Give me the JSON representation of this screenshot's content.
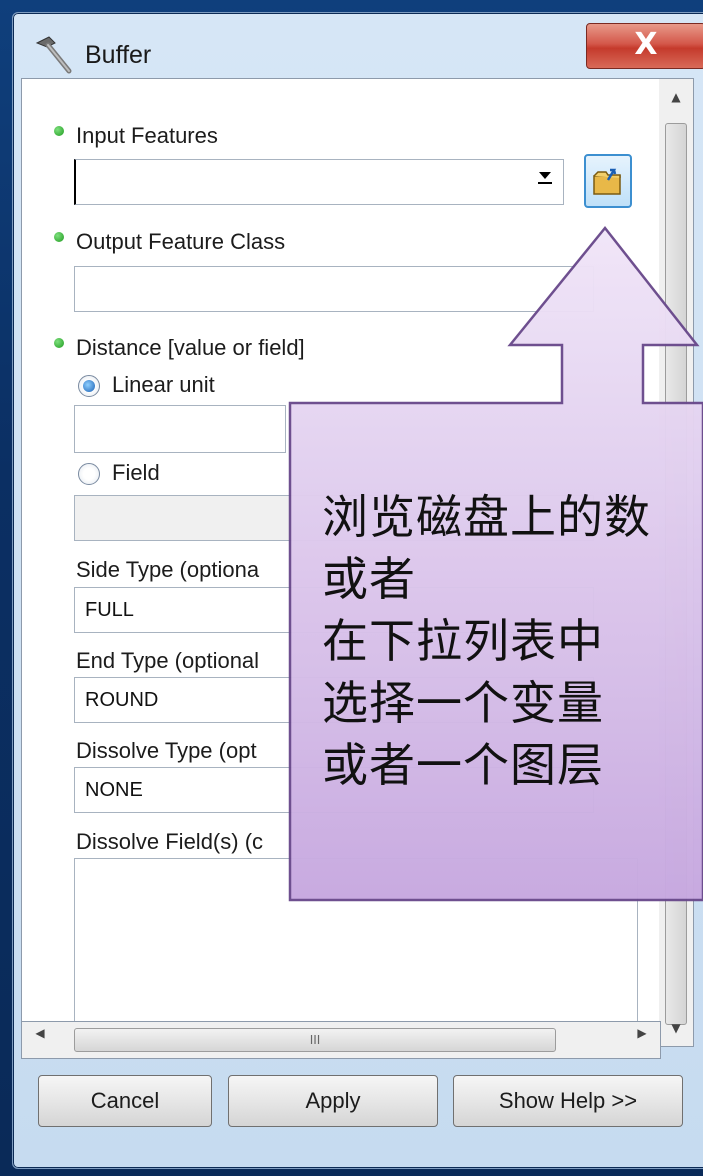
{
  "window": {
    "title": "Buffer",
    "close_label": "X"
  },
  "form": {
    "input_features": {
      "label": "Input Features",
      "value": ""
    },
    "output_feature_class": {
      "label": "Output Feature Class",
      "value": ""
    },
    "distance": {
      "label": "Distance [value or field]",
      "linear_unit_label": "Linear unit",
      "linear_unit_value": "",
      "field_label": "Field",
      "field_value": "",
      "selected": "Linear unit"
    },
    "side_type": {
      "label": "Side Type (optiona",
      "value": "FULL"
    },
    "end_type": {
      "label": "End Type (optional",
      "value": "ROUND"
    },
    "dissolve_type": {
      "label": "Dissolve Type (opt",
      "value": "NONE"
    },
    "dissolve_fields": {
      "label": "Dissolve Field(s) (c"
    }
  },
  "scrollbar": {
    "thumb_grip": "III"
  },
  "buttons": {
    "cancel": "Cancel",
    "apply": "Apply",
    "show_help": "Show Help >>"
  },
  "callout": {
    "lines": [
      "浏览磁盘上的数",
      "或者",
      "在下拉列表中",
      "选择一个变量",
      "或者一个图层"
    ]
  },
  "colors": {
    "desktop": "#0f3f7c",
    "required_dot": "#1e9a1e",
    "callout_fill": "#dcc8ec",
    "callout_border": "#6a4a8c",
    "browse_button": "#3c8fd0"
  },
  "icons": {
    "title": "hammer-icon",
    "browse": "open-folder-icon",
    "dropdown": "chevron-down-icon"
  }
}
